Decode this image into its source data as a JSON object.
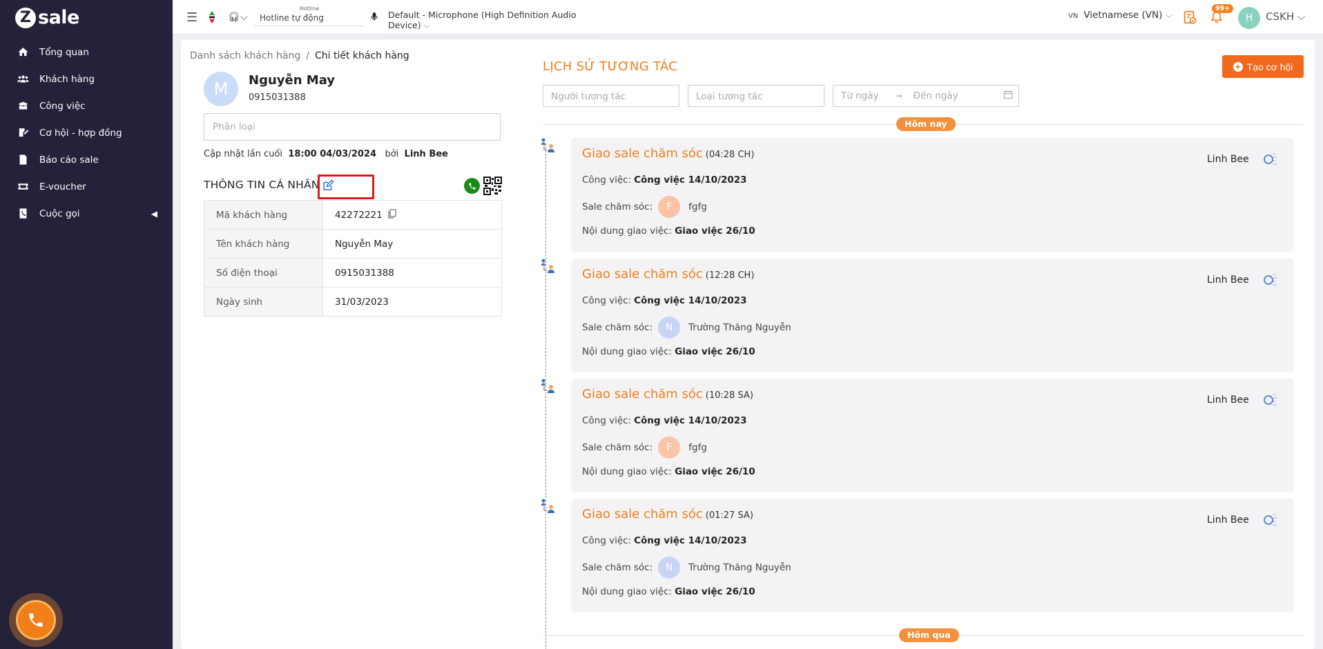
{
  "app": {
    "logo_mark": "Z",
    "logo_text": "sale"
  },
  "sidebar": {
    "items": [
      {
        "label": "Tổng quan",
        "icon": "home-icon"
      },
      {
        "label": "Khách hàng",
        "icon": "users-icon"
      },
      {
        "label": "Công việc",
        "icon": "briefcase-icon"
      },
      {
        "label": "Cơ hội - hợp đồng",
        "icon": "contract-icon"
      },
      {
        "label": "Báo cáo sale",
        "icon": "report-icon"
      },
      {
        "label": "E-voucher",
        "icon": "voucher-icon"
      },
      {
        "label": "Cuộc gọi",
        "icon": "phone-book-icon",
        "caret": "◀"
      }
    ]
  },
  "topbar": {
    "hotline_label": "Hotline",
    "hotline_value": "Hotline tự động",
    "device": "Default - Microphone (High Definition Audio Device)",
    "lang_code": "VN",
    "lang_label": "Vietnamese (VN)",
    "notif_count": "99+",
    "user_initial": "H",
    "user_name": "CSKH"
  },
  "breadcrumb": {
    "parent": "Danh sách khách hàng",
    "sep": "/",
    "current": "Chi tiết khách hàng"
  },
  "customer": {
    "initial": "M",
    "name": "Nguyễn May",
    "phone": "0915031388",
    "classify_placeholder": "Phân loại",
    "updated_label": "Cập nhật lần cuối",
    "updated_time": "18:00 04/03/2024",
    "updated_by_label": "bởi",
    "updated_by": "Linh Bee"
  },
  "personal": {
    "title": "THÔNG TIN CÁ NHÂN",
    "rows": [
      {
        "key": "Mã khách hàng",
        "value": "42272221"
      },
      {
        "key": "Tên khách hàng",
        "value": "Nguyễn May"
      },
      {
        "key": "Số điện thoại",
        "value": "0915031388"
      },
      {
        "key": "Ngày sinh",
        "value": "31/03/2023"
      }
    ]
  },
  "history": {
    "title": "LỊCH SỬ TƯƠNG TÁC",
    "create_label": "Tạo cơ hội",
    "filters": {
      "actor_placeholder": "Người tương tác",
      "type_placeholder": "Loại tương tác",
      "from_placeholder": "Từ ngày",
      "to_placeholder": "Đến ngày"
    },
    "day_today": "Hôm nay",
    "day_yesterday": "Hôm qua",
    "task_label": "Công việc:",
    "sale_label": "Sale chăm sóc:",
    "content_label": "Nội dung giao việc:",
    "cards": [
      {
        "title": "Giao sale chăm sóc",
        "time": "(04:28 CH)",
        "task": "Công việc 14/10/2023",
        "sale_initial": "F",
        "sale_name": "fgfg",
        "content": "Giao việc 26/10",
        "actor": "Linh Bee"
      },
      {
        "title": "Giao sale chăm sóc",
        "time": "(12:28 CH)",
        "task": "Công việc 14/10/2023",
        "sale_initial": "N",
        "sale_name": "Trường Thăng Nguyễn",
        "content": "Giao việc 26/10",
        "actor": "Linh Bee"
      },
      {
        "title": "Giao sale chăm sóc",
        "time": "(10:28 SA)",
        "task": "Công việc 14/10/2023",
        "sale_initial": "F",
        "sale_name": "fgfg",
        "content": "Giao việc 26/10",
        "actor": "Linh Bee"
      },
      {
        "title": "Giao sale chăm sóc",
        "time": "(01:27 SA)",
        "task": "Công việc 14/10/2023",
        "sale_initial": "N",
        "sale_name": "Trường Thăng Nguyễn",
        "content": "Giao việc 26/10",
        "actor": "Linh Bee"
      }
    ]
  },
  "colors": {
    "accent": "#f07f1a",
    "sidebar_bg": "#24223a",
    "highlight": "#e0181e"
  }
}
